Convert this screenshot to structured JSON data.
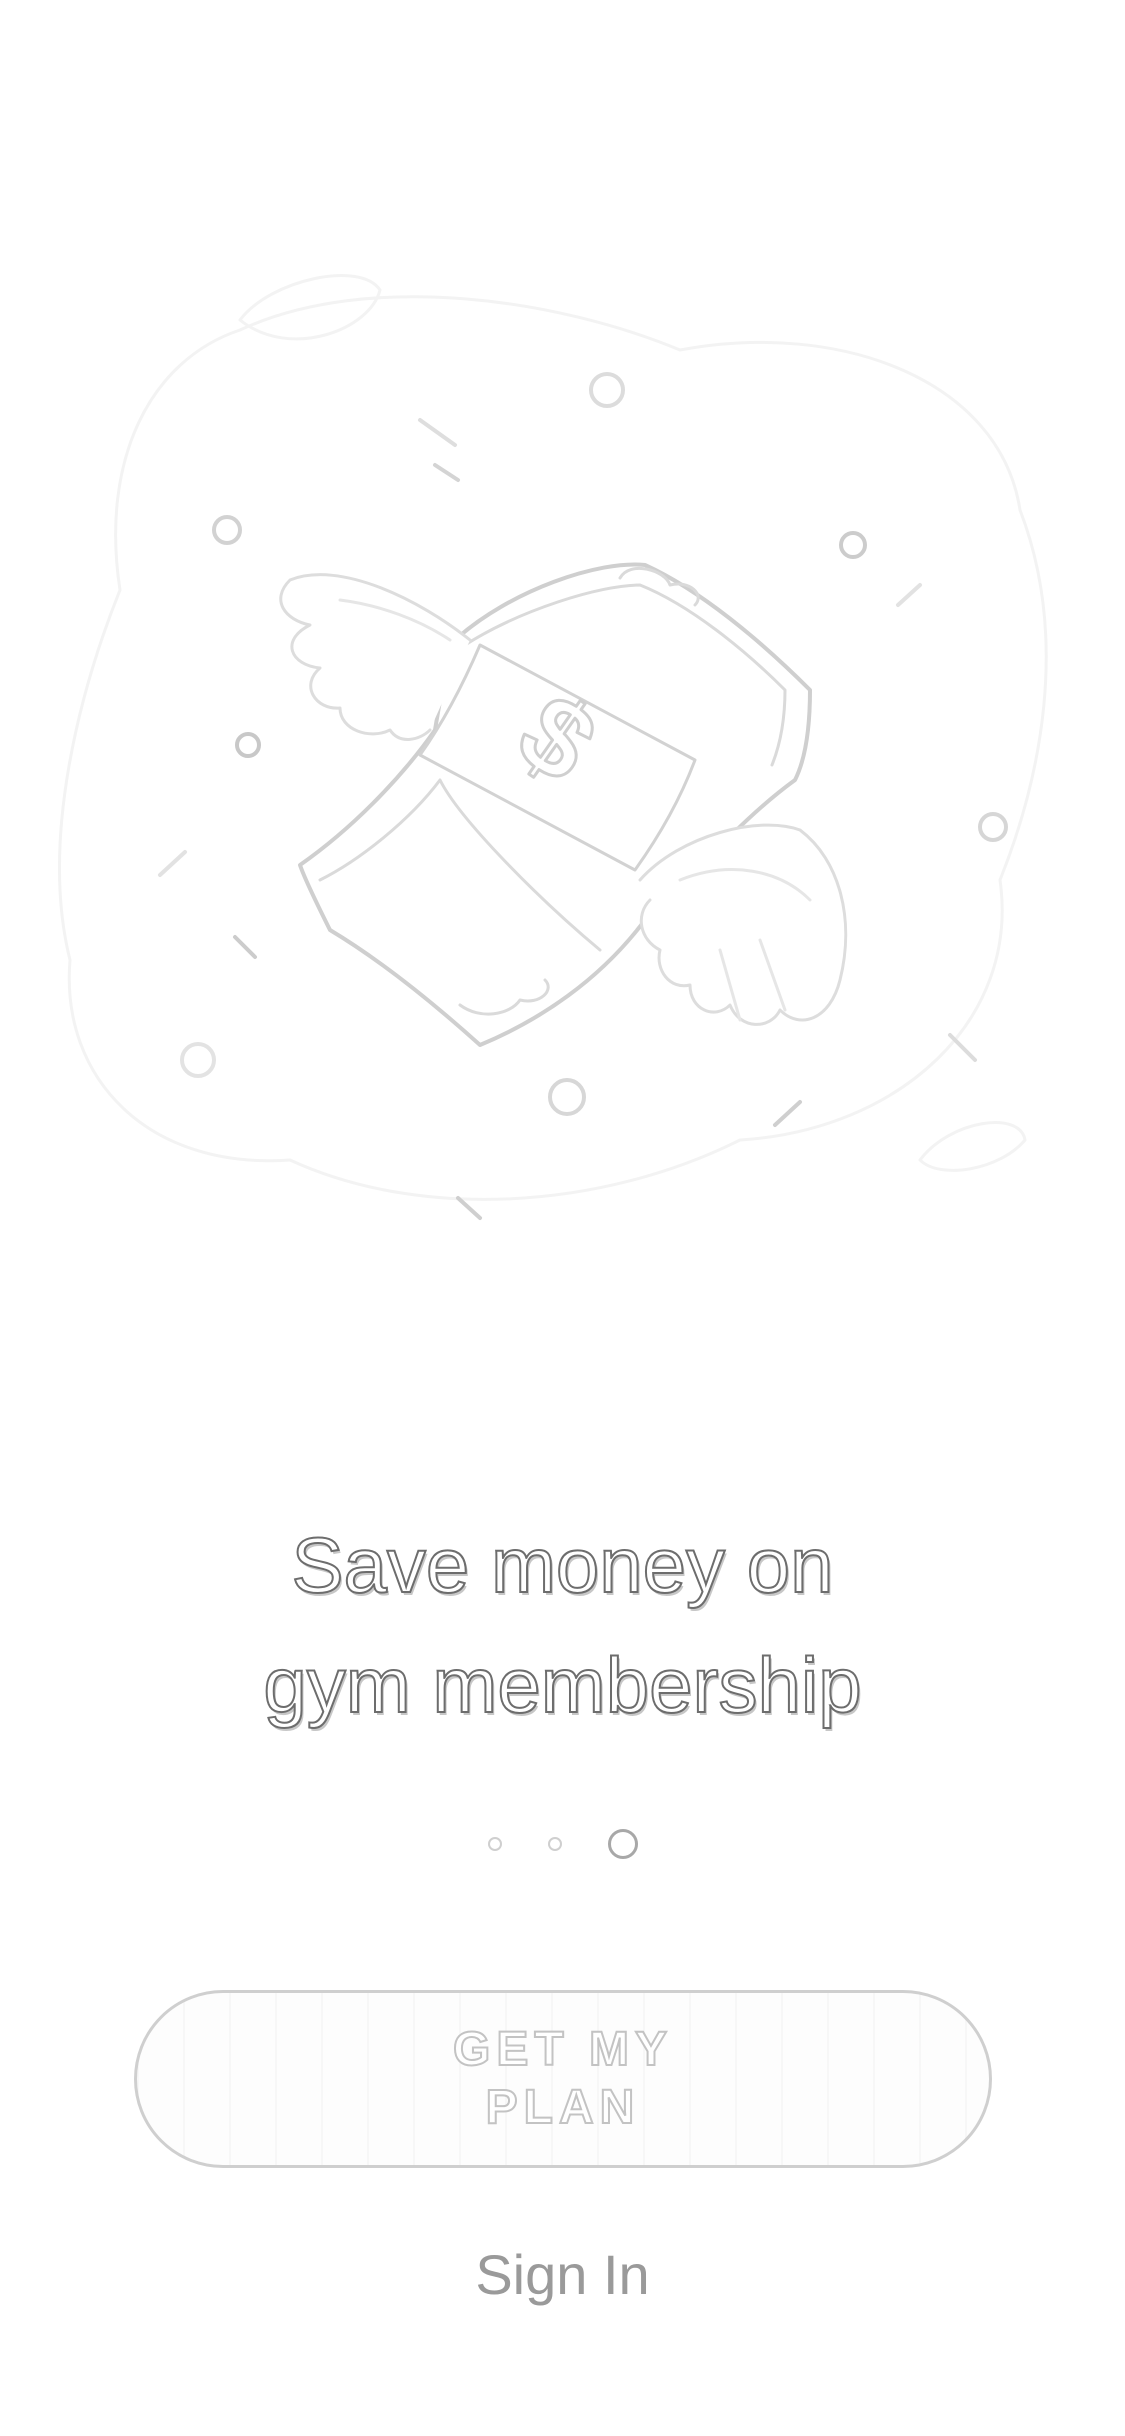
{
  "onboarding": {
    "illustration": {
      "icon": "flying-money-icon",
      "symbol": "$"
    },
    "headline": {
      "line1": "Save money on",
      "line2": "gym membership"
    },
    "pager": {
      "total": 3,
      "current": 3
    },
    "primary_button": {
      "label": "GET MY PLAN"
    },
    "secondary_link": {
      "label": "Sign In"
    }
  },
  "colors": {
    "background": "#ffffff",
    "line_art": "#cfcfcf",
    "headline_outline": "#6d6d6d",
    "button_border": "#cfcfcf",
    "link": "#9a9a9a"
  }
}
